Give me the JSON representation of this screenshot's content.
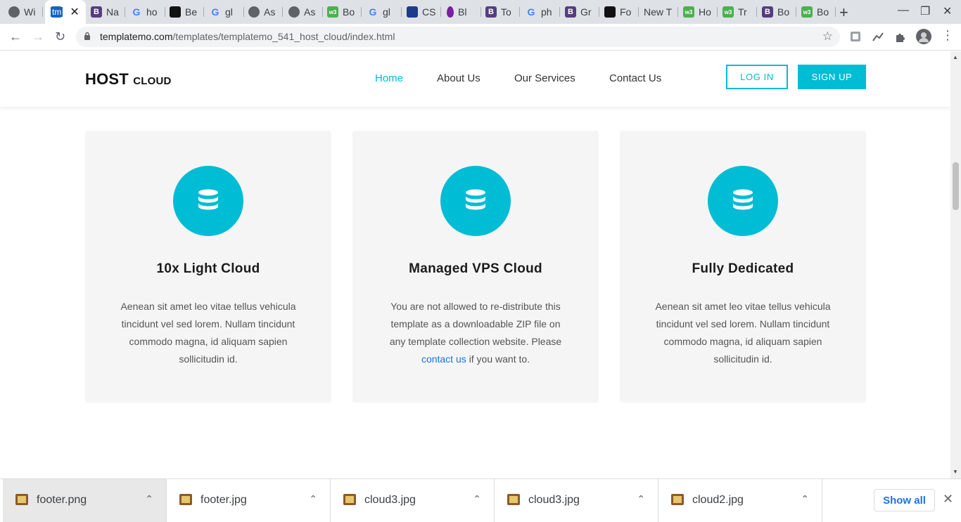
{
  "browser": {
    "tabs": [
      {
        "title": "Wi",
        "icon": "globe-icon",
        "color": "#5f6368"
      },
      {
        "title": "tm",
        "icon": "templatemo-icon",
        "color": "#1565c0",
        "active": true
      },
      {
        "title": "Na",
        "icon": "bootstrap-icon",
        "color": "#563d7c"
      },
      {
        "title": "ho",
        "icon": "google-icon",
        "color": "#4285f4"
      },
      {
        "title": "Be",
        "icon": "site-icon",
        "color": "#111111"
      },
      {
        "title": "gl",
        "icon": "google-icon",
        "color": "#4285f4"
      },
      {
        "title": "As",
        "icon": "globe-icon",
        "color": "#5f6368"
      },
      {
        "title": "As",
        "icon": "globe-icon",
        "color": "#5f6368"
      },
      {
        "title": "Bo",
        "icon": "w3-icon",
        "color": "#4caf50"
      },
      {
        "title": "gl",
        "icon": "google-icon",
        "color": "#4285f4"
      },
      {
        "title": "CS",
        "icon": "site-icon",
        "color": "#1e3a8a"
      },
      {
        "title": "Bl",
        "icon": "drop-icon",
        "color": "#7b1fa2"
      },
      {
        "title": "To",
        "icon": "bootstrap-icon",
        "color": "#563d7c"
      },
      {
        "title": "ph",
        "icon": "google-icon",
        "color": "#4285f4"
      },
      {
        "title": "Gr",
        "icon": "bootstrap-icon",
        "color": "#563d7c"
      },
      {
        "title": "Fo",
        "icon": "flag-icon",
        "color": "#111111"
      },
      {
        "title": "New T",
        "icon": "",
        "color": ""
      },
      {
        "title": "Ho",
        "icon": "w3-icon",
        "color": "#4caf50"
      },
      {
        "title": "Tr",
        "icon": "w3-icon",
        "color": "#4caf50"
      },
      {
        "title": "Bo",
        "icon": "bootstrap-icon",
        "color": "#563d7c"
      },
      {
        "title": "Bo",
        "icon": "w3-icon",
        "color": "#4caf50"
      }
    ],
    "close_tab": "✕",
    "new_tab": "+",
    "address": {
      "domain": "templatemo.com",
      "path": "/templates/templatemo_541_host_cloud/index.html"
    }
  },
  "site": {
    "logo_main": "HOST",
    "logo_sub": "CLOUD",
    "nav": [
      "Home",
      "About Us",
      "Our Services",
      "Contact Us"
    ],
    "login": "LOG IN",
    "signup": "SIGN UP",
    "accent": "#00bcd4"
  },
  "cards": [
    {
      "title": "10x Light Cloud",
      "text": "Aenean sit amet leo vitae tellus vehicula tincidunt vel sed lorem. Nullam tincidunt commodo magna, id aliquam sapien sollicitudin id."
    },
    {
      "title": "Managed VPS Cloud",
      "text_before": "You are not allowed to re-distribute this template as a downloadable ZIP file on any template collection website. Please",
      "link": "contact us",
      "text_after": "if you want to."
    },
    {
      "title": "Fully Dedicated",
      "text": "Aenean sit amet leo vitae tellus vehicula tincidunt vel sed lorem. Nullam tincidunt commodo magna, id aliquam sapien sollicitudin id."
    }
  ],
  "downloads": {
    "items": [
      "footer.png",
      "footer.jpg",
      "cloud3.jpg",
      "cloud3.jpg",
      "cloud2.jpg"
    ],
    "show_all": "Show all"
  }
}
